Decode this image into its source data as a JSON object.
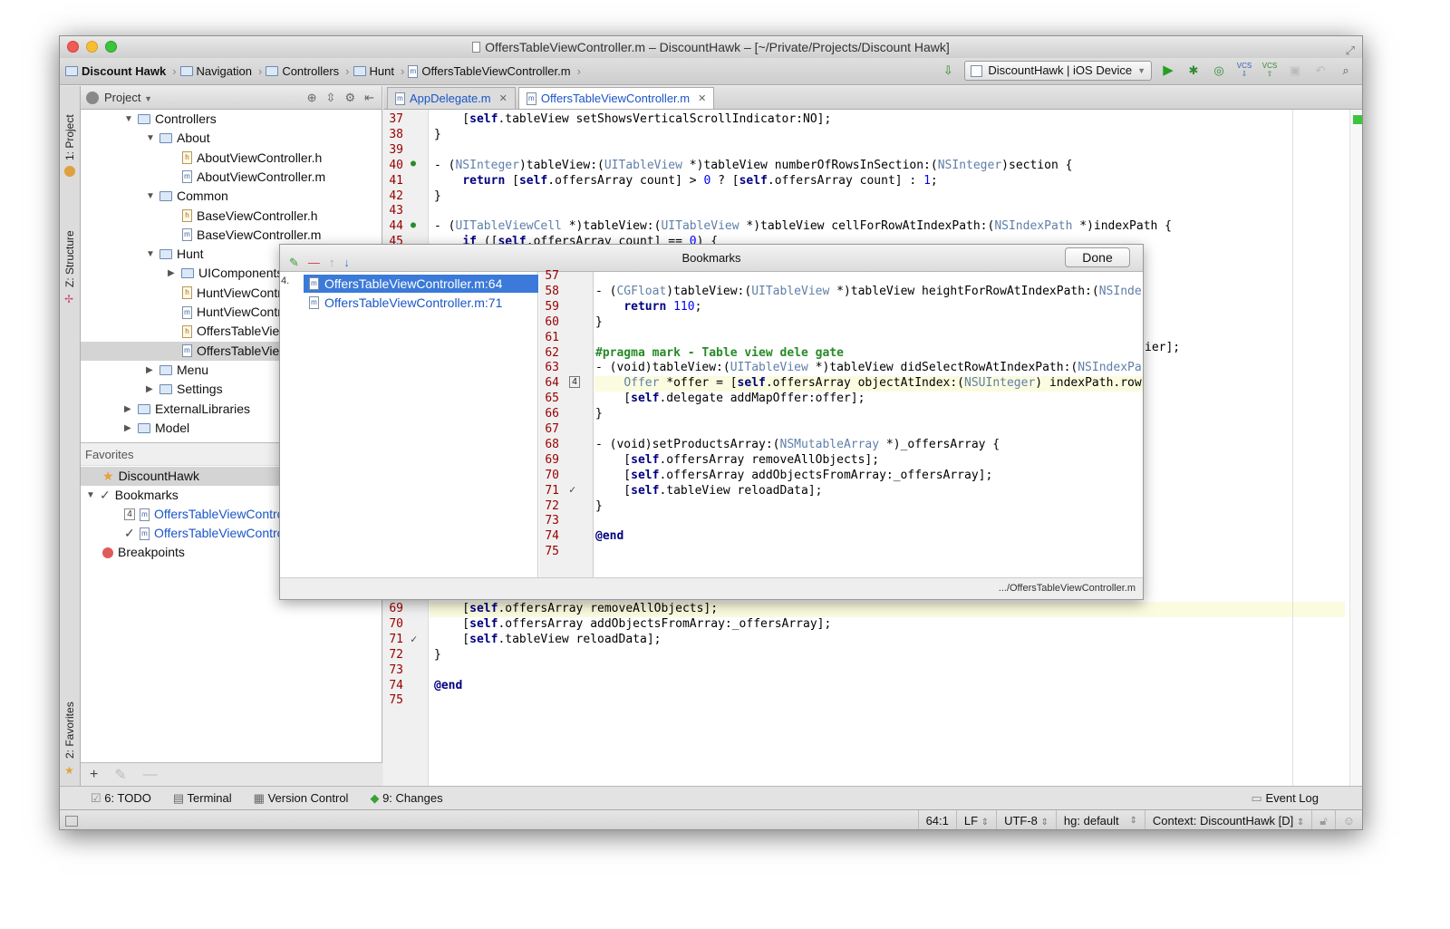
{
  "window": {
    "title": "OffersTableViewController.m – DiscountHawk – [~/Private/Projects/Discount Hawk]"
  },
  "breadcrumb": [
    "Discount Hawk",
    "Navigation",
    "Controllers",
    "Hunt",
    "OffersTableViewController.m"
  ],
  "run_config": "DiscountHawk | iOS Device",
  "vcs_labels": [
    "VCS",
    "VCS"
  ],
  "left_tabs": {
    "project": "1: Project",
    "structure": "Z: Structure",
    "favorites": "2: Favorites"
  },
  "project_panel": {
    "title": "Project"
  },
  "tree": [
    {
      "label": "Controllers",
      "type": "folder",
      "open": true,
      "level": 0
    },
    {
      "label": "About",
      "type": "folder",
      "open": true,
      "level": 1
    },
    {
      "label": "AboutViewController.h",
      "type": "h",
      "level": 2
    },
    {
      "label": "AboutViewController.m",
      "type": "m",
      "level": 2
    },
    {
      "label": "Common",
      "type": "folder",
      "open": true,
      "level": 1
    },
    {
      "label": "BaseViewController.h",
      "type": "h",
      "level": 2
    },
    {
      "label": "BaseViewController.m",
      "type": "m",
      "level": 2
    },
    {
      "label": "Hunt",
      "type": "folder",
      "open": true,
      "level": 1
    },
    {
      "label": "UIComponents",
      "type": "folder",
      "open": false,
      "level": 2
    },
    {
      "label": "HuntViewController.h",
      "type": "h",
      "level": 2
    },
    {
      "label": "HuntViewController.m",
      "type": "m",
      "level": 2
    },
    {
      "label": "OffersTableViewController.h",
      "type": "h",
      "level": 2
    },
    {
      "label": "OffersTableViewController.m",
      "type": "m",
      "level": 2
    },
    {
      "label": "Menu",
      "type": "folder",
      "open": false,
      "level": 1
    },
    {
      "label": "Settings",
      "type": "folder",
      "open": false,
      "level": 1
    },
    {
      "label": "ExternalLibraries",
      "type": "folder",
      "open": false,
      "level": 0
    },
    {
      "label": "Model",
      "type": "folder",
      "open": false,
      "level": 0
    }
  ],
  "favorites": {
    "title": "Favorites",
    "items": [
      {
        "label": "DiscountHawk"
      },
      {
        "label": "Bookmarks"
      },
      {
        "label": "OffersTableViewController.m:64"
      },
      {
        "label": "OffersTableViewController.m:71"
      },
      {
        "label": "Breakpoints"
      }
    ],
    "bookmark_badges": [
      "4",
      "✓"
    ]
  },
  "tabs": [
    {
      "label": "AppDelegate.m"
    },
    {
      "label": "OffersTableViewController.m"
    }
  ],
  "editor_lines": [
    {
      "n": "37",
      "t": "    [self.tableView setShowsVerticalScrollIndicator:NO];"
    },
    {
      "n": "38",
      "t": "}"
    },
    {
      "n": "39",
      "t": ""
    },
    {
      "n": "40",
      "t": "- (NSInteger)tableView:(UITableView *)tableView numberOfRowsInSection:(NSInteger)section {"
    },
    {
      "n": "41",
      "t": "    return [self.offersArray count] > 0 ? [self.offersArray count] : 1;"
    },
    {
      "n": "42",
      "t": "}"
    },
    {
      "n": "43",
      "t": ""
    },
    {
      "n": "44",
      "t": "- (UITableViewCell *)tableView:(UITableView *)tableView cellForRowAtIndexPath:(NSIndexPath *)indexPath {"
    },
    {
      "n": "45",
      "t": "    if ([self.offersArray count] == 0) {"
    }
  ],
  "editor_lines_bottom": [
    {
      "n": "69",
      "t": "    [self.offersArray removeAllObjects];"
    },
    {
      "n": "70",
      "t": "    [self.offersArray addObjectsFromArray:_offersArray];"
    },
    {
      "n": "71",
      "t": "    [self.tableView reloadData];"
    },
    {
      "n": "72",
      "t": "}"
    },
    {
      "n": "73",
      "t": ""
    },
    {
      "n": "74",
      "t": "@end"
    },
    {
      "n": "75",
      "t": ""
    }
  ],
  "editor_fragment": "ier];",
  "bookmarks_popup": {
    "title": "Bookmarks",
    "done": "Done",
    "items": [
      {
        "label": "OffersTableViewController.m:64",
        "mnemonic": "4."
      },
      {
        "label": "OffersTableViewController.m:71"
      }
    ],
    "lines": [
      {
        "n": "57",
        "t": ""
      },
      {
        "n": "58",
        "t": "- (CGFloat)tableView:(UITableView *)tableView heightForRowAtIndexPath:(NSInde"
      },
      {
        "n": "59",
        "t": "    return 110;"
      },
      {
        "n": "60",
        "t": "}"
      },
      {
        "n": "61",
        "t": ""
      },
      {
        "n": "62",
        "t": "#pragma mark - Table view dele gate"
      },
      {
        "n": "63",
        "t": "- (void)tableView:(UITableView *)tableView didSelectRowAtIndexPath:(NSIndexPa"
      },
      {
        "n": "64",
        "t": "    Offer *offer = [self.offersArray objectAtIndex:(NSUInteger) indexPath.row];"
      },
      {
        "n": "65",
        "t": "    [self.delegate addMapOffer:offer];"
      },
      {
        "n": "66",
        "t": "}"
      },
      {
        "n": "67",
        "t": ""
      },
      {
        "n": "68",
        "t": "- (void)setProductsArray:(NSMutableArray *)_offersArray {"
      },
      {
        "n": "69",
        "t": "    [self.offersArray removeAllObjects];"
      },
      {
        "n": "70",
        "t": "    [self.offersArray addObjectsFromArray:_offersArray];"
      },
      {
        "n": "71",
        "t": "    [self.tableView reloadData];"
      },
      {
        "n": "72",
        "t": "}"
      },
      {
        "n": "73",
        "t": ""
      },
      {
        "n": "74",
        "t": "@end"
      },
      {
        "n": "75",
        "t": ""
      }
    ],
    "gutter_badge": "4",
    "footer": ".../OffersTableViewController.m"
  },
  "bottom_tools": [
    {
      "label": "6: TODO"
    },
    {
      "label": "Terminal"
    },
    {
      "label": "Version Control"
    },
    {
      "label": "9: Changes"
    }
  ],
  "event_log": "Event Log",
  "status": {
    "position": "64:1",
    "line_sep": "LF",
    "encoding": "UTF-8",
    "vcs": "hg: default",
    "context": "Context: DiscountHawk [D]"
  },
  "colors": {
    "accent": "#3b7ad9",
    "link": "#1a55c8",
    "line_number": "#990000",
    "keyword": "#000080"
  }
}
